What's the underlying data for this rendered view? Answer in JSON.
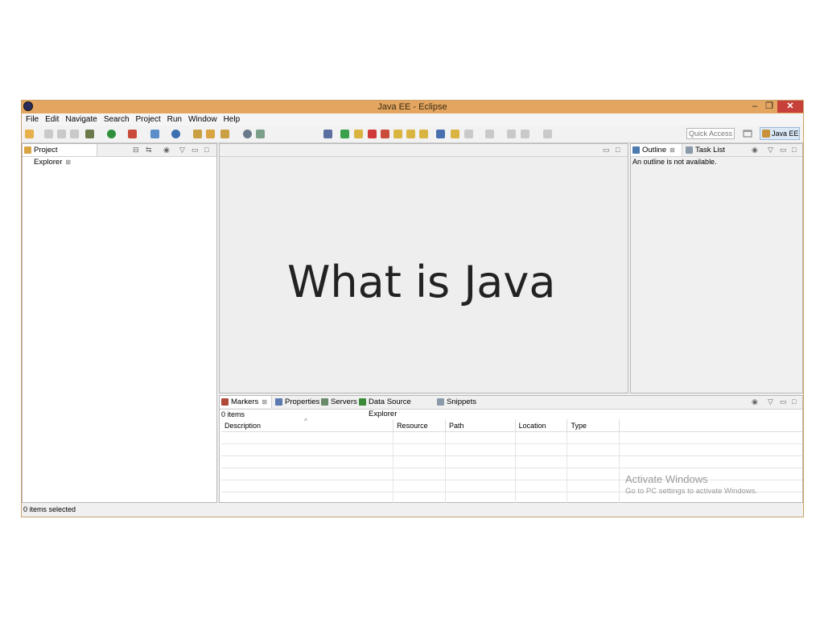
{
  "window": {
    "title": "Java EE - Eclipse",
    "controls": {
      "minimize": "–",
      "restore": "❐",
      "close": "✕"
    }
  },
  "menu": [
    "File",
    "Edit",
    "Navigate",
    "Search",
    "Project",
    "Run",
    "Window",
    "Help"
  ],
  "toolbar": {
    "quick_access_placeholder": "Quick Access",
    "perspective": "Java EE"
  },
  "project_explorer": {
    "tab": "Project Explorer",
    "close": "⊠"
  },
  "editor": {
    "overlay_text": "What is Java"
  },
  "outline": {
    "tabs": [
      "Outline",
      "Task List"
    ],
    "close": "⊠",
    "message": "An outline is not available."
  },
  "bottom": {
    "tabs": [
      "Markers",
      "Properties",
      "Servers",
      "Data Source Explorer",
      "Snippets"
    ],
    "close": "⊠",
    "count": "0 items",
    "columns": [
      "Description",
      "Resource",
      "Path",
      "Location",
      "Type"
    ]
  },
  "watermark": {
    "line1": "Activate Windows",
    "line2": "Go to PC settings to activate Windows."
  },
  "status_bar": "0 items selected",
  "colors": {
    "titlebar": "#e3a55f",
    "close": "#c7403a",
    "perspective": "#dbe9f7"
  }
}
